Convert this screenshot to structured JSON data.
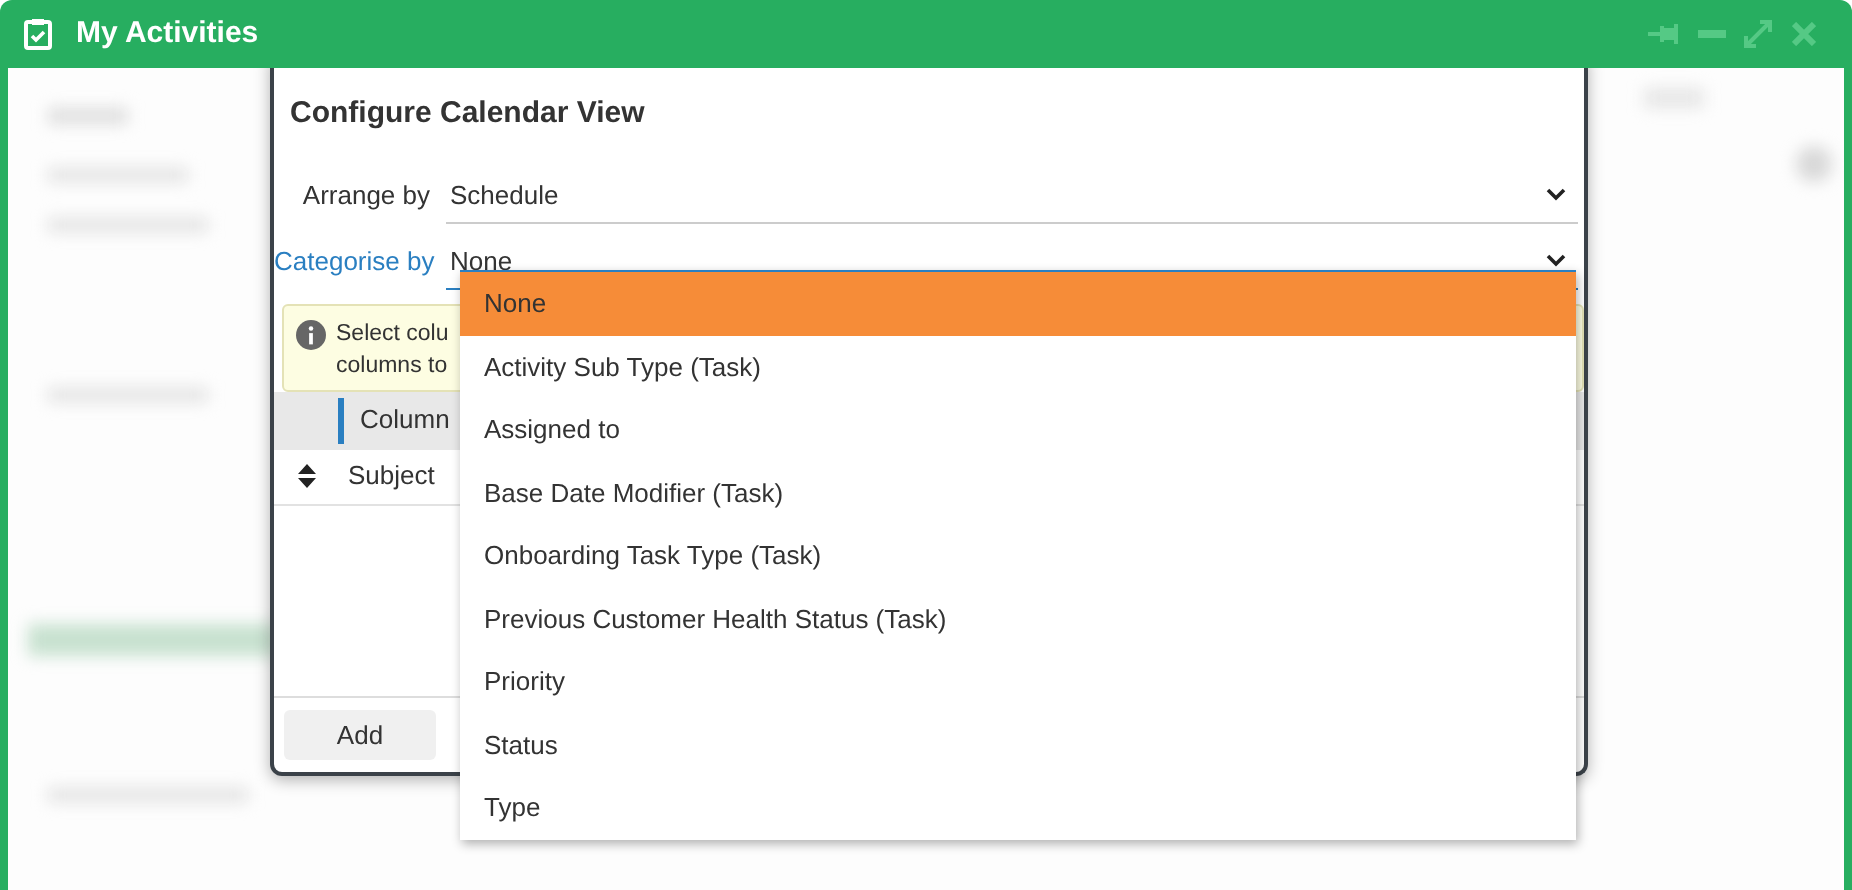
{
  "window": {
    "title": "My Activities"
  },
  "dialog": {
    "title": "Configure Calendar View",
    "fields": [
      {
        "label": "Arrange by",
        "value": "Schedule",
        "focused": false
      },
      {
        "label": "Categorise by",
        "value": "None",
        "focused": true
      }
    ],
    "info": {
      "lines": [
        "Select colu",
        "columns to"
      ]
    },
    "table": {
      "columns": [
        "Column"
      ],
      "rows": [
        {
          "cells": [
            "Subject"
          ]
        }
      ]
    },
    "buttons": [
      "Add"
    ]
  },
  "dropdown": {
    "options": [
      {
        "label": "None",
        "selected": true
      },
      {
        "label": "Activity Sub Type (Task)",
        "selected": false
      },
      {
        "label": "Assigned to",
        "selected": false
      },
      {
        "label": "Base Date Modifier (Task)",
        "selected": false
      },
      {
        "label": "Onboarding Task Type (Task)",
        "selected": false
      },
      {
        "label": "Previous Customer Health Status (Task)",
        "selected": false
      },
      {
        "label": "Priority",
        "selected": false
      },
      {
        "label": "Status",
        "selected": false
      },
      {
        "label": "Type",
        "selected": false
      }
    ]
  }
}
